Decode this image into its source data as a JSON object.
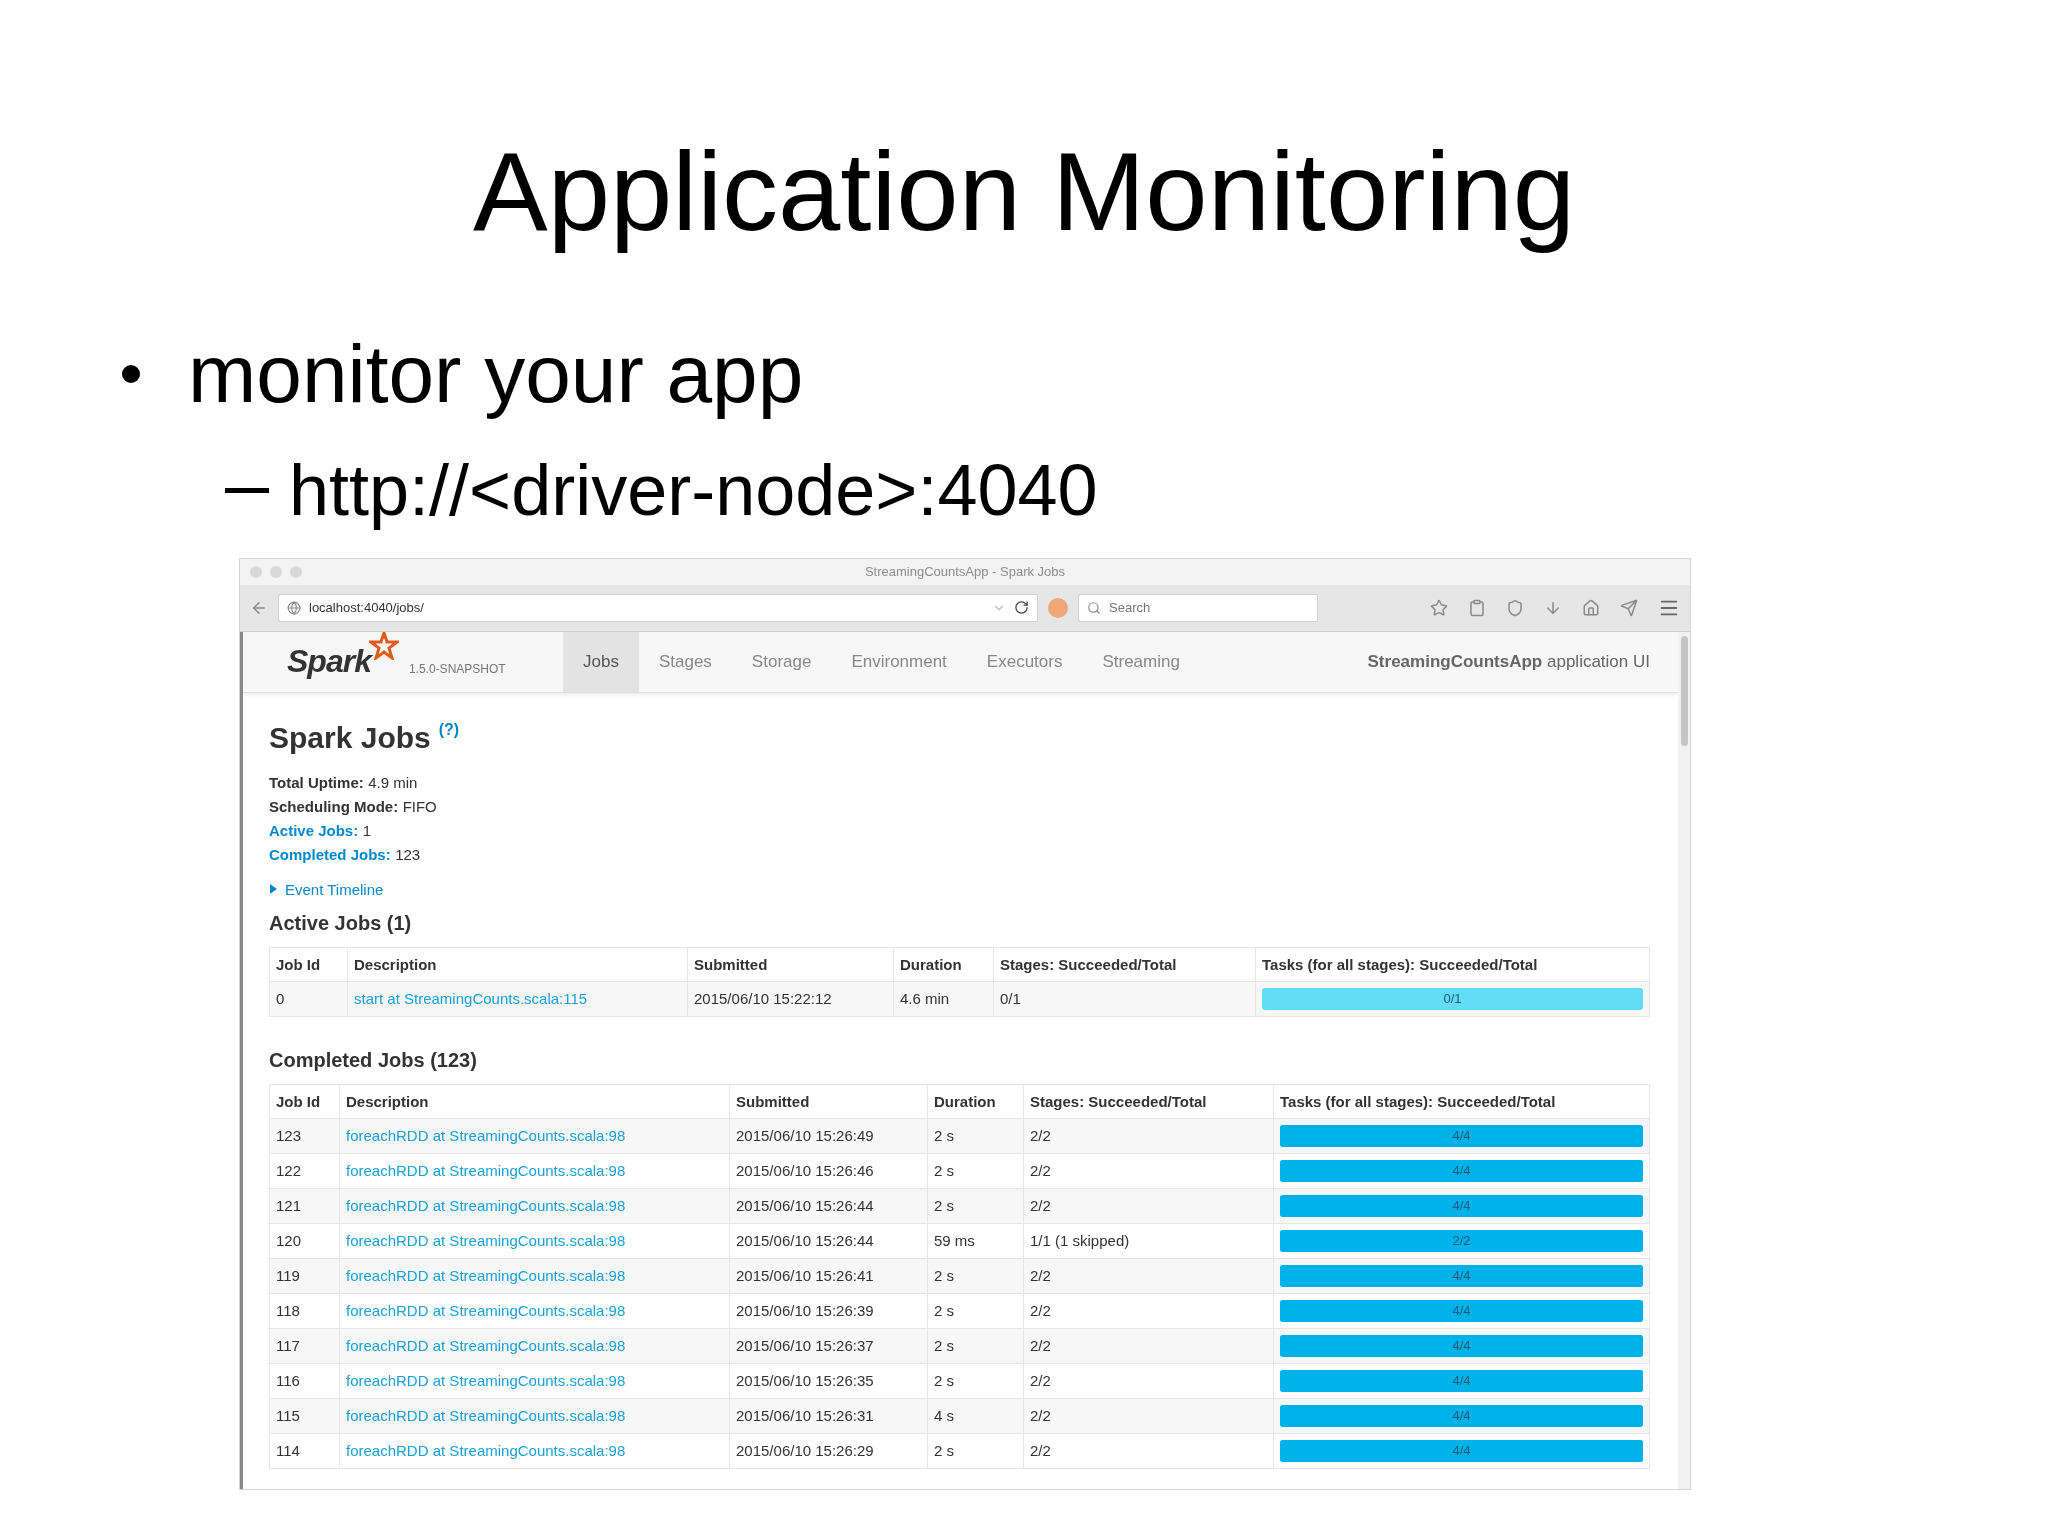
{
  "slide": {
    "title": "Application Monitoring",
    "bullet": "monitor your app",
    "sub_bullet": "http://<driver-node>:4040"
  },
  "browser": {
    "window_title": "StreamingCountsApp - Spark Jobs",
    "address": "localhost:4040/jobs/",
    "search": {
      "placeholder": "Search"
    }
  },
  "spark_nav": {
    "logo": "Spark",
    "version": "1.5.0-SNAPSHOT",
    "tabs": [
      {
        "label": "Jobs",
        "selected": true
      },
      {
        "label": "Stages",
        "selected": false
      },
      {
        "label": "Storage",
        "selected": false
      },
      {
        "label": "Environment",
        "selected": false
      },
      {
        "label": "Executors",
        "selected": false
      },
      {
        "label": "Streaming",
        "selected": false
      }
    ],
    "app_name": "**StreamingCountsApp** application UI"
  },
  "page": {
    "heading": "Spark Jobs",
    "help": "(?)",
    "summary": [
      {
        "label": "Total Uptime:",
        "value": "4.9 min",
        "kind": "plain"
      },
      {
        "label": "Scheduling Mode:",
        "value": "FIFO",
        "kind": "plain"
      },
      {
        "label": "Active Jobs:",
        "value": "1",
        "kind": "link"
      },
      {
        "label": "Completed Jobs:",
        "value": "123",
        "kind": "link"
      }
    ],
    "event_timeline": {
      "label": "Event Timeline",
      "expanded": false
    },
    "active_jobs": {
      "title": "Active Jobs (1)",
      "columns": [
        "Job Id",
        "Description",
        "Submitted",
        "Duration",
        "Stages: Succeeded/Total",
        "Tasks (for all stages): Succeeded/Total"
      ],
      "rows": [
        {
          "job_id": "0",
          "description": "start at StreamingCounts.scala:115",
          "submitted": "2015/06/10 15:22:12",
          "duration": "4.6 min",
          "stages": "0/1",
          "tasks": {
            "label": "0/1",
            "level": 0
          }
        }
      ]
    },
    "completed_jobs": {
      "title": "Completed Jobs (123)",
      "columns": [
        "Job Id",
        "Description",
        "Submitted",
        "Duration",
        "Stages: Succeeded/Total",
        "Tasks (for all stages): Succeeded/Total"
      ],
      "rows": [
        {
          "job_id": "123",
          "description": "foreachRDD at StreamingCounts.scala:98",
          "submitted": "2015/06/10 15:26:49",
          "duration": "2 s",
          "stages": "2/2",
          "tasks": {
            "label": "4/4",
            "level": 1
          }
        },
        {
          "job_id": "122",
          "description": "foreachRDD at StreamingCounts.scala:98",
          "submitted": "2015/06/10 15:26:46",
          "duration": "2 s",
          "stages": "2/2",
          "tasks": {
            "label": "4/4",
            "level": 1
          }
        },
        {
          "job_id": "121",
          "description": "foreachRDD at StreamingCounts.scala:98",
          "submitted": "2015/06/10 15:26:44",
          "duration": "2 s",
          "stages": "2/2",
          "tasks": {
            "label": "4/4",
            "level": 1
          }
        },
        {
          "job_id": "120",
          "description": "foreachRDD at StreamingCounts.scala:98",
          "submitted": "2015/06/10 15:26:44",
          "duration": "59 ms",
          "stages": "1/1 (1 skipped)",
          "tasks": {
            "label": "2/2",
            "level": 1
          }
        },
        {
          "job_id": "119",
          "description": "foreachRDD at StreamingCounts.scala:98",
          "submitted": "2015/06/10 15:26:41",
          "duration": "2 s",
          "stages": "2/2",
          "tasks": {
            "label": "4/4",
            "level": 1
          }
        },
        {
          "job_id": "118",
          "description": "foreachRDD at StreamingCounts.scala:98",
          "submitted": "2015/06/10 15:26:39",
          "duration": "2 s",
          "stages": "2/2",
          "tasks": {
            "label": "4/4",
            "level": 1
          }
        },
        {
          "job_id": "117",
          "description": "foreachRDD at StreamingCounts.scala:98",
          "submitted": "2015/06/10 15:26:37",
          "duration": "2 s",
          "stages": "2/2",
          "tasks": {
            "label": "4/4",
            "level": 1
          }
        },
        {
          "job_id": "116",
          "description": "foreachRDD at StreamingCounts.scala:98",
          "submitted": "2015/06/10 15:26:35",
          "duration": "2 s",
          "stages": "2/2",
          "tasks": {
            "label": "4/4",
            "level": 1
          }
        },
        {
          "job_id": "115",
          "description": "foreachRDD at StreamingCounts.scala:98",
          "submitted": "2015/06/10 15:26:31",
          "duration": "4 s",
          "stages": "2/2",
          "tasks": {
            "label": "4/4",
            "level": 1
          }
        },
        {
          "job_id": "114",
          "description": "foreachRDD at StreamingCounts.scala:98",
          "submitted": "2015/06/10 15:26:29",
          "duration": "2 s",
          "stages": "2/2",
          "tasks": {
            "label": "4/4",
            "level": 1
          }
        }
      ]
    }
  }
}
